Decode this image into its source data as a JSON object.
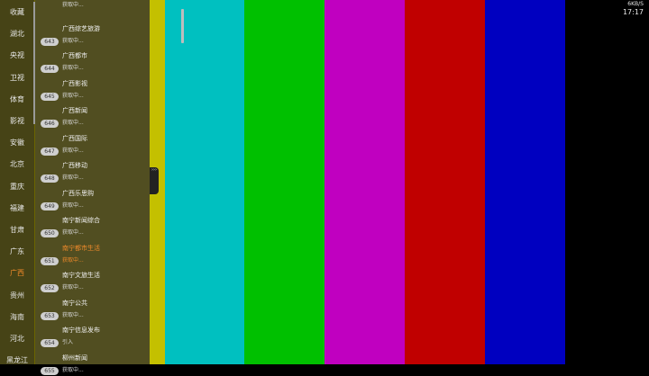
{
  "test_pattern": {
    "colors": [
      "#c4c000",
      "#00c0c0",
      "#00c000",
      "#c000c0",
      "#c00000",
      "#0000c0",
      "#000000"
    ]
  },
  "status": {
    "speed": "6KB/S",
    "clock": "17:17"
  },
  "categories": [
    {
      "label": "收藏"
    },
    {
      "label": "湖北"
    },
    {
      "label": "央视"
    },
    {
      "label": "卫视"
    },
    {
      "label": "体育"
    },
    {
      "label": "影视"
    },
    {
      "label": "安徽"
    },
    {
      "label": "北京"
    },
    {
      "label": "重庆"
    },
    {
      "label": "福建"
    },
    {
      "label": "甘肃"
    },
    {
      "label": "广东"
    },
    {
      "label": "广西",
      "active": true
    },
    {
      "label": "贵州"
    },
    {
      "label": "海南"
    },
    {
      "label": "河北"
    },
    {
      "label": "黑龙江"
    }
  ],
  "channels": [
    {
      "num": "",
      "name": "",
      "status": "获取中..."
    },
    {
      "num": "643",
      "name": "广西综艺旅游",
      "status": "获取中..."
    },
    {
      "num": "644",
      "name": "广西都市",
      "status": "获取中..."
    },
    {
      "num": "645",
      "name": "广西影视",
      "status": "获取中..."
    },
    {
      "num": "646",
      "name": "广西新闻",
      "status": "获取中..."
    },
    {
      "num": "647",
      "name": "广西国际",
      "status": "获取中..."
    },
    {
      "num": "648",
      "name": "广西移动",
      "status": "获取中..."
    },
    {
      "num": "649",
      "name": "广西乐思购",
      "status": "获取中..."
    },
    {
      "num": "650",
      "name": "南宁新闻综合",
      "status": "获取中..."
    },
    {
      "num": "651",
      "name": "南宁都市生活",
      "status": "获取中...",
      "active": true
    },
    {
      "num": "652",
      "name": "南宁文旅生活",
      "status": "获取中..."
    },
    {
      "num": "653",
      "name": "南宁公共",
      "status": "获取中..."
    },
    {
      "num": "654",
      "name": "南宁信息发布",
      "status": "引入"
    },
    {
      "num": "655",
      "name": "柳州新闻",
      "status": "获取中..."
    }
  ],
  "handle_label": "›››"
}
